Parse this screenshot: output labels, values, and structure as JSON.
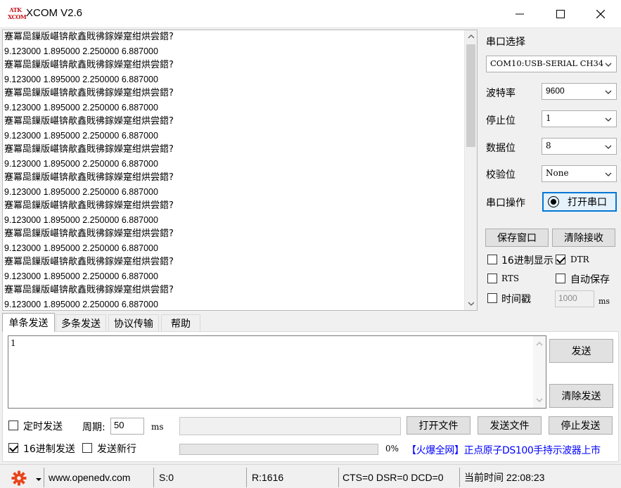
{
  "window": {
    "logo_top": "ATK",
    "logo_bottom": "XCOM",
    "title": "XCOM V2.6"
  },
  "receive": {
    "lines": [
      {
        "kind": "t",
        "text": "蹇冪巼鏁版嵁锛歄鑫戝彿鎵嬫寔绀烘尝鍣?"
      },
      {
        "kind": "n",
        "text": "9.123000 1.895000 2.250000 6.887000"
      },
      {
        "kind": "t",
        "text": "蹇冪巼鏁版嵁锛歄鑫戝彿鎵嬫寔绀烘尝鍣?"
      },
      {
        "kind": "n",
        "text": "9.123000 1.895000 2.250000 6.887000"
      },
      {
        "kind": "t",
        "text": "蹇冪巼鏁版嵁锛歄鑫戝彿鎵嬫寔绀烘尝鍣?"
      },
      {
        "kind": "n",
        "text": "9.123000 1.895000 2.250000 6.887000"
      },
      {
        "kind": "t",
        "text": "蹇冪巼鏁版嵁锛歄鑫戝彿鎵嬫寔绀烘尝鍣?"
      },
      {
        "kind": "n",
        "text": "9.123000 1.895000 2.250000 6.887000"
      },
      {
        "kind": "t",
        "text": "蹇冪巼鏁版嵁锛歄鑫戝彿鎵嬫寔绀烘尝鍣?"
      },
      {
        "kind": "n",
        "text": "9.123000 1.895000 2.250000 6.887000"
      },
      {
        "kind": "t",
        "text": "蹇冪巼鏁版嵁锛歄鑫戝彿鎵嬫寔绀烘尝鍣?"
      },
      {
        "kind": "n",
        "text": "9.123000 1.895000 2.250000 6.887000"
      },
      {
        "kind": "t",
        "text": "蹇冪巼鏁版嵁锛歄鑫戝彿鎵嬫寔绀烘尝鍣?"
      },
      {
        "kind": "n",
        "text": "9.123000 1.895000 2.250000 6.887000"
      },
      {
        "kind": "t",
        "text": "蹇冪巼鏁版嵁锛歄鑫戝彿鎵嬫寔绀烘尝鍣?"
      },
      {
        "kind": "n",
        "text": "9.123000 1.895000 2.250000 6.887000"
      },
      {
        "kind": "t",
        "text": "蹇冪巼鏁版嵁锛歄鑫戝彿鎵嬫寔绀烘尝鍣?"
      },
      {
        "kind": "n",
        "text": "9.123000 1.895000 2.250000 6.887000"
      },
      {
        "kind": "t",
        "text": "蹇冪巼鏁版嵁锛歄鑫戝彿鎵嬫寔绀烘尝鍣?"
      },
      {
        "kind": "n",
        "text": "9.123000 1.895000 2.250000 6.887000"
      }
    ]
  },
  "settings": {
    "port_select_label": "串口选择",
    "port_value": "COM10:USB-SERIAL CH34",
    "baud_label": "波特率",
    "baud_value": "9600",
    "stop_label": "停止位",
    "stop_value": "1",
    "data_label": "数据位",
    "data_value": "8",
    "parity_label": "校验位",
    "parity_value": "None",
    "port_op_label": "串口操作",
    "open_button": "打开串口",
    "save_window_button": "保存窗口",
    "clear_receive_button": "清除接收",
    "hex_display_label": "16进制显示",
    "dtr_label": "DTR",
    "rts_label": "RTS",
    "auto_save_label": "自动保存",
    "timestamp_label": "时间戳",
    "timestamp_ms_value": "1000",
    "ms_unit": "ms"
  },
  "tabs": [
    "单条发送",
    "多条发送",
    "协议传输",
    "帮助"
  ],
  "send": {
    "text": "1",
    "send_button": "发送",
    "clear_send_button": "清除发送",
    "timed_send_label": "定时发送",
    "period_label": "周期:",
    "period_value": "50",
    "ms_unit": "ms",
    "open_file_button": "打开文件",
    "send_file_button": "发送文件",
    "stop_send_button": "停止发送",
    "hex_send_label": "16进制发送",
    "send_newline_label": "发送新行",
    "progress_text": "0%",
    "progress_fraction": 0,
    "ad_text": "【火爆全网】正点原子DS100手持示波器上市"
  },
  "status": {
    "website": "www.openedv.com",
    "sent": "S:0",
    "received": "R:1616",
    "signals": "CTS=0 DSR=0 DCD=0",
    "time": "当前时间 22:08:23"
  },
  "colors": {
    "accent": "#0078d7",
    "logo_red": "#c8161d",
    "gear_orange": "#e8461d",
    "ad_blue": "#0000ff"
  }
}
